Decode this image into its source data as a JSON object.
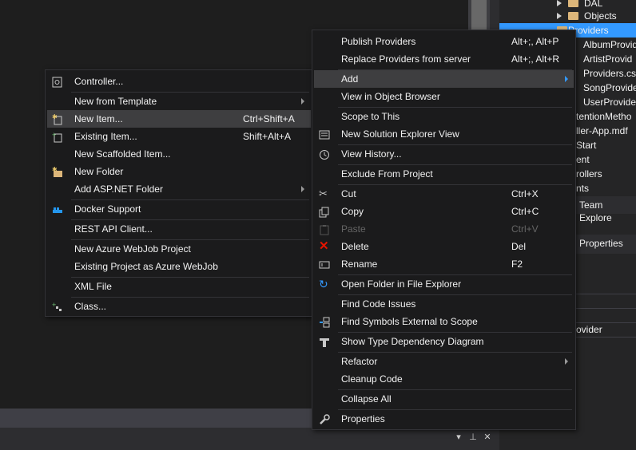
{
  "solution_explorer": {
    "rows": [
      {
        "label": "DAL",
        "icon": "folder-icon"
      },
      {
        "label": "Objects",
        "icon": "folder-icon"
      },
      {
        "label": "Providers",
        "icon": "folder-icon",
        "selected": true
      },
      {
        "label": "AlbumProvid"
      },
      {
        "label": "ArtistProvid"
      },
      {
        "label": "Providers.cs"
      },
      {
        "label": "SongProvide"
      },
      {
        "label": "UserProvider"
      },
      {
        "label": "tentionMetho"
      },
      {
        "label": "ller-App.mdf"
      },
      {
        "label": "Start"
      },
      {
        "label": "ent"
      },
      {
        "label": "rollers"
      },
      {
        "label": "nts"
      }
    ],
    "tab_label": "Team Explore",
    "properties_label": "Properties",
    "property_value": "ovider"
  },
  "add_submenu": {
    "items": [
      {
        "label": "Controller...",
        "shortcut": "",
        "icon": "controller-icon"
      },
      {
        "label": "New from Template",
        "shortcut": "",
        "submenu": true
      },
      {
        "label": "New Item...",
        "shortcut": "Ctrl+Shift+A",
        "icon": "new-item-icon",
        "highlighted": true
      },
      {
        "label": "Existing Item...",
        "shortcut": "Shift+Alt+A",
        "icon": "existing-item-icon"
      },
      {
        "label": "New Scaffolded Item...",
        "shortcut": ""
      },
      {
        "label": "New Folder",
        "shortcut": "",
        "icon": "new-folder-icon"
      },
      {
        "label": "Add ASP.NET Folder",
        "shortcut": "",
        "submenu": true
      },
      {
        "label": "Docker Support",
        "shortcut": "",
        "icon": "docker-icon"
      },
      {
        "label": "REST API Client...",
        "shortcut": ""
      },
      {
        "label": "New Azure WebJob Project",
        "shortcut": ""
      },
      {
        "label": "Existing Project as Azure WebJob",
        "shortcut": ""
      },
      {
        "label": "XML File",
        "shortcut": ""
      },
      {
        "label": "Class...",
        "shortcut": "",
        "icon": "class-icon"
      }
    ]
  },
  "context_menu": {
    "items": [
      {
        "label": "Publish Providers",
        "shortcut": "Alt+;, Alt+P"
      },
      {
        "label": "Replace Providers from server",
        "shortcut": "Alt+;, Alt+R"
      },
      {
        "label": "Add",
        "shortcut": "",
        "submenu": true,
        "highlighted": true
      },
      {
        "label": "View in Object Browser",
        "shortcut": ""
      },
      {
        "label": "Scope to This",
        "shortcut": ""
      },
      {
        "label": "New Solution Explorer View",
        "shortcut": "",
        "icon": "new-view-icon"
      },
      {
        "label": "View History...",
        "shortcut": "",
        "icon": "history-icon"
      },
      {
        "label": "Exclude From Project",
        "shortcut": ""
      },
      {
        "label": "Cut",
        "shortcut": "Ctrl+X",
        "icon": "scissors-icon"
      },
      {
        "label": "Copy",
        "shortcut": "Ctrl+C",
        "icon": "copy-icon"
      },
      {
        "label": "Paste",
        "shortcut": "Ctrl+V",
        "icon": "paste-icon",
        "disabled": true
      },
      {
        "label": "Delete",
        "shortcut": "Del",
        "icon": "delete-icon"
      },
      {
        "label": "Rename",
        "shortcut": "F2",
        "icon": "rename-icon"
      },
      {
        "label": "Open Folder in File Explorer",
        "shortcut": "",
        "icon": "refresh-arrow-icon"
      },
      {
        "label": "Find Code Issues",
        "shortcut": ""
      },
      {
        "label": "Find Symbols External to Scope",
        "shortcut": "",
        "icon": "find-symbols-icon"
      },
      {
        "label": "Show Type Dependency Diagram",
        "shortcut": "",
        "icon": "type-diagram-icon"
      },
      {
        "label": "Refactor",
        "shortcut": "",
        "submenu": true
      },
      {
        "label": "Cleanup Code",
        "shortcut": ""
      },
      {
        "label": "Collapse All",
        "shortcut": ""
      },
      {
        "label": "Properties",
        "shortcut": "",
        "icon": "wrench-icon"
      }
    ]
  },
  "colors": {
    "menu_bg": "#1b1b1c",
    "highlight": "#3e3e40",
    "selection": "#3399ff",
    "delete_red": "#e51400"
  }
}
